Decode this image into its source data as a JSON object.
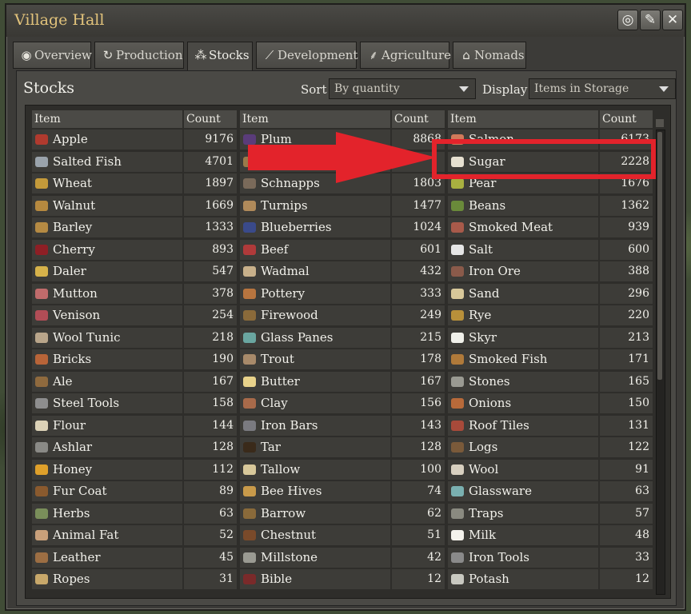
{
  "window": {
    "title": "Village Hall",
    "buttons": [
      "target-icon",
      "pin-icon",
      "close-icon"
    ]
  },
  "tabs": [
    {
      "label": "Overview",
      "icon": "eye-icon"
    },
    {
      "label": "Production",
      "icon": "cycle-icon"
    },
    {
      "label": "Stocks",
      "icon": "stack-icon",
      "active": true
    },
    {
      "label": "Development",
      "icon": "chart-icon"
    },
    {
      "label": "Agriculture",
      "icon": "wheat-icon"
    },
    {
      "label": "Nomads",
      "icon": "house-icon"
    }
  ],
  "stocks": {
    "title": "Stocks",
    "sort_label": "Sort",
    "sort_value": "By quantity",
    "display_label": "Display",
    "display_value": "Items in Storage",
    "headers": {
      "item": "Item",
      "count": "Count"
    },
    "columns": [
      [
        {
          "name": "Apple",
          "count": "9176",
          "color": "#b03a2e"
        },
        {
          "name": "Salted Fish",
          "count": "4701",
          "color": "#9aa3ab"
        },
        {
          "name": "Wheat",
          "count": "1897",
          "color": "#c49a3a"
        },
        {
          "name": "Walnut",
          "count": "1669",
          "color": "#b6893f"
        },
        {
          "name": "Barley",
          "count": "1333",
          "color": "#b58a43"
        },
        {
          "name": "Cherry",
          "count": "893",
          "color": "#8e1f25"
        },
        {
          "name": "Daler",
          "count": "547",
          "color": "#d6b24a"
        },
        {
          "name": "Mutton",
          "count": "378",
          "color": "#c06b6b"
        },
        {
          "name": "Venison",
          "count": "254",
          "color": "#b24d56"
        },
        {
          "name": "Wool Tunic",
          "count": "218",
          "color": "#b9a58a"
        },
        {
          "name": "Bricks",
          "count": "190",
          "color": "#b86438"
        },
        {
          "name": "Ale",
          "count": "167",
          "color": "#8f6a3e"
        },
        {
          "name": "Steel Tools",
          "count": "158",
          "color": "#8e8e8e"
        },
        {
          "name": "Flour",
          "count": "144",
          "color": "#dcd2b7"
        },
        {
          "name": "Ashlar",
          "count": "128",
          "color": "#8a8a86"
        },
        {
          "name": "Honey",
          "count": "112",
          "color": "#dfa02a"
        },
        {
          "name": "Fur Coat",
          "count": "89",
          "color": "#8a5a2e"
        },
        {
          "name": "Herbs",
          "count": "63",
          "color": "#7a8e5a"
        },
        {
          "name": "Animal Fat",
          "count": "52",
          "color": "#c9a07a"
        },
        {
          "name": "Leather",
          "count": "45",
          "color": "#9c6e43"
        },
        {
          "name": "Ropes",
          "count": "31",
          "color": "#c8a86a"
        }
      ],
      [
        {
          "name": "Plum",
          "count": "8868",
          "color": "#5a3c7a"
        },
        {
          "name": "",
          "count": "",
          "color": "#9a7a4a"
        },
        {
          "name": "Schnapps",
          "count": "1803",
          "color": "#7a6a5a"
        },
        {
          "name": "Turnips",
          "count": "1477",
          "color": "#b08a5a"
        },
        {
          "name": "Blueberries",
          "count": "1024",
          "color": "#3a4a8a"
        },
        {
          "name": "Beef",
          "count": "601",
          "color": "#b03a3a"
        },
        {
          "name": "Wadmal",
          "count": "432",
          "color": "#c8b08a"
        },
        {
          "name": "Pottery",
          "count": "333",
          "color": "#b8753f"
        },
        {
          "name": "Firewood",
          "count": "249",
          "color": "#8a6a3a"
        },
        {
          "name": "Glass Panes",
          "count": "215",
          "color": "#6aa6a0"
        },
        {
          "name": "Trout",
          "count": "178",
          "color": "#a88a6a"
        },
        {
          "name": "Butter",
          "count": "167",
          "color": "#e8d28a"
        },
        {
          "name": "Clay",
          "count": "156",
          "color": "#a86a4a"
        },
        {
          "name": "Iron Bars",
          "count": "143",
          "color": "#7a7a80"
        },
        {
          "name": "Tar",
          "count": "128",
          "color": "#3a2a1a"
        },
        {
          "name": "Tallow",
          "count": "100",
          "color": "#d8c89a"
        },
        {
          "name": "Bee Hives",
          "count": "74",
          "color": "#c89a4a"
        },
        {
          "name": "Barrow",
          "count": "62",
          "color": "#8a6a3a"
        },
        {
          "name": "Chestnut",
          "count": "51",
          "color": "#7a4a2a"
        },
        {
          "name": "Millstone",
          "count": "42",
          "color": "#9a9a92"
        },
        {
          "name": "Bible",
          "count": "12",
          "color": "#7a2a2a"
        }
      ],
      [
        {
          "name": "Salmon",
          "count": "6173",
          "color": "#d07a5a"
        },
        {
          "name": "Sugar",
          "count": "2228",
          "color": "#e6e0d0"
        },
        {
          "name": "Pear",
          "count": "1676",
          "color": "#a8b040"
        },
        {
          "name": "Beans",
          "count": "1362",
          "color": "#6a8a3a"
        },
        {
          "name": "Smoked Meat",
          "count": "939",
          "color": "#a85a4a"
        },
        {
          "name": "Salt",
          "count": "600",
          "color": "#e6e6e6"
        },
        {
          "name": "Iron Ore",
          "count": "388",
          "color": "#8a5a4a"
        },
        {
          "name": "Sand",
          "count": "296",
          "color": "#d8c89a"
        },
        {
          "name": "Rye",
          "count": "220",
          "color": "#b8903a"
        },
        {
          "name": "Skyr",
          "count": "213",
          "color": "#f0f0ea"
        },
        {
          "name": "Smoked Fish",
          "count": "171",
          "color": "#b07a3a"
        },
        {
          "name": "Stones",
          "count": "165",
          "color": "#9a9a92"
        },
        {
          "name": "Onions",
          "count": "150",
          "color": "#b86a3a"
        },
        {
          "name": "Roof Tiles",
          "count": "131",
          "color": "#a84a3a"
        },
        {
          "name": "Logs",
          "count": "122",
          "color": "#7a5a3a"
        },
        {
          "name": "Wool",
          "count": "91",
          "color": "#d8d0c0"
        },
        {
          "name": "Glassware",
          "count": "63",
          "color": "#7ab0b0"
        },
        {
          "name": "Traps",
          "count": "57",
          "color": "#8a8a80"
        },
        {
          "name": "Milk",
          "count": "48",
          "color": "#f4f2ec"
        },
        {
          "name": "Iron Tools",
          "count": "33",
          "color": "#8a8a8a"
        },
        {
          "name": "Potash",
          "count": "12",
          "color": "#c8c8c0"
        }
      ]
    ]
  },
  "annotation": {
    "highlight_color": "#e3232b"
  }
}
